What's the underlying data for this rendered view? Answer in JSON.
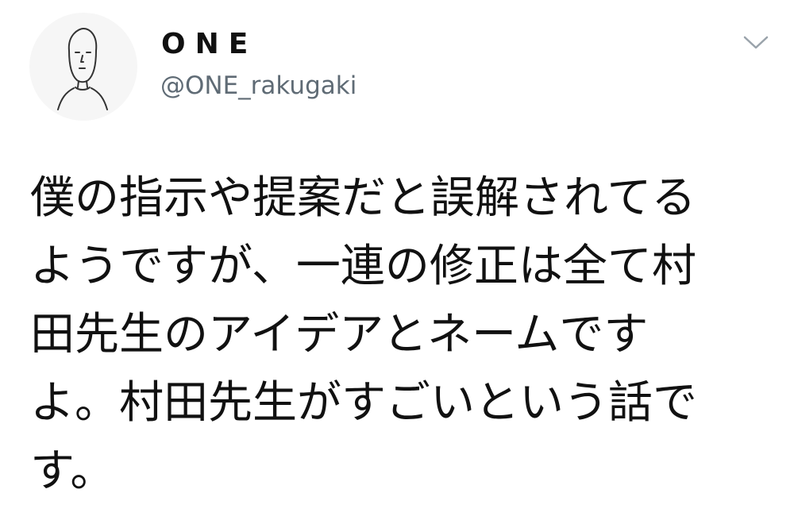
{
  "user": {
    "display_name": "ONE",
    "handle": "@ONE_rakugaki",
    "avatar_icon": "bald-man-doodle-icon"
  },
  "menu": {
    "icon": "chevron-down-icon"
  },
  "tweet": {
    "lines": [
      "僕の指示や提案だと誤解されてる",
      "ようですが、一連の修正は全て村",
      "田先生のアイデアとネームです",
      "よ。村田先生がすごいという話で",
      "す。"
    ]
  },
  "colors": {
    "text": "#111111",
    "handle": "#5f6b75",
    "background": "#ffffff",
    "chevron": "#9aa3ab"
  }
}
